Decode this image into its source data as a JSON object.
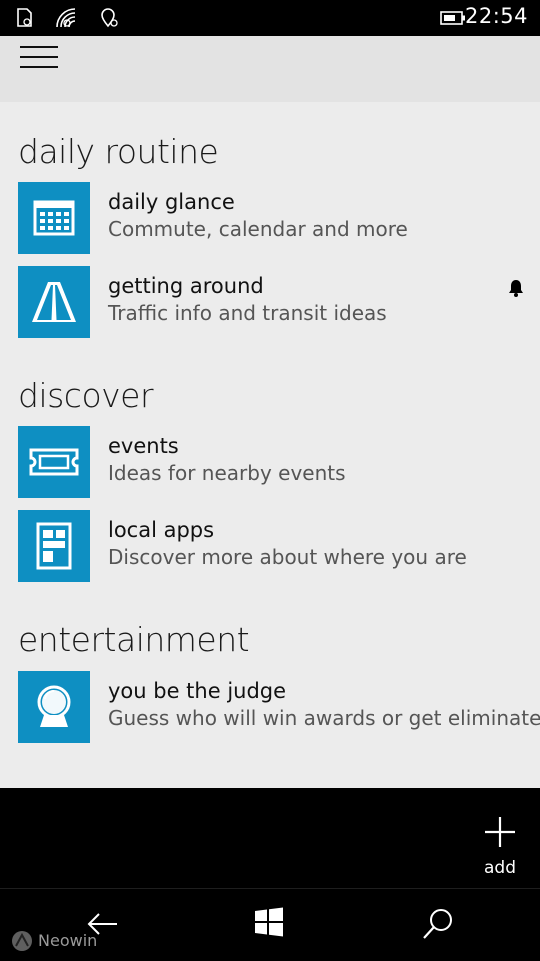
{
  "status_bar": {
    "time": "22:54",
    "icons": [
      "sim-icon",
      "wifi-icon",
      "location-icon",
      "battery-icon"
    ]
  },
  "header": {
    "menu_icon": "hamburger-icon"
  },
  "sections": [
    {
      "title": "daily routine",
      "items": [
        {
          "title": "daily glance",
          "subtitle": "Commute, calendar and more",
          "icon": "calendar-icon"
        },
        {
          "title": "getting around",
          "subtitle": "Traffic info and transit ideas",
          "icon": "road-icon",
          "badge_icon": "bell-icon"
        }
      ]
    },
    {
      "title": "discover",
      "items": [
        {
          "title": "events",
          "subtitle": "Ideas for nearby events",
          "icon": "ticket-icon"
        },
        {
          "title": "local apps",
          "subtitle": "Discover more about where you are",
          "icon": "app-layout-icon"
        }
      ]
    },
    {
      "title": "entertainment",
      "items": [
        {
          "title": "you be the judge",
          "subtitle": "Guess who will win awards or get eliminated",
          "icon": "crystal-ball-icon"
        }
      ]
    }
  ],
  "app_bar": {
    "add_label": "add",
    "add_icon": "plus-icon"
  },
  "nav_bar": {
    "back_icon": "back-arrow-icon",
    "start_icon": "windows-logo-icon",
    "search_icon": "search-icon"
  },
  "watermark": {
    "text": "Neowin"
  },
  "colors": {
    "tile_blue": "#0e8fc2",
    "background": "#ececec",
    "header_bg": "#e3e3e3",
    "bar_bg": "#000000"
  }
}
